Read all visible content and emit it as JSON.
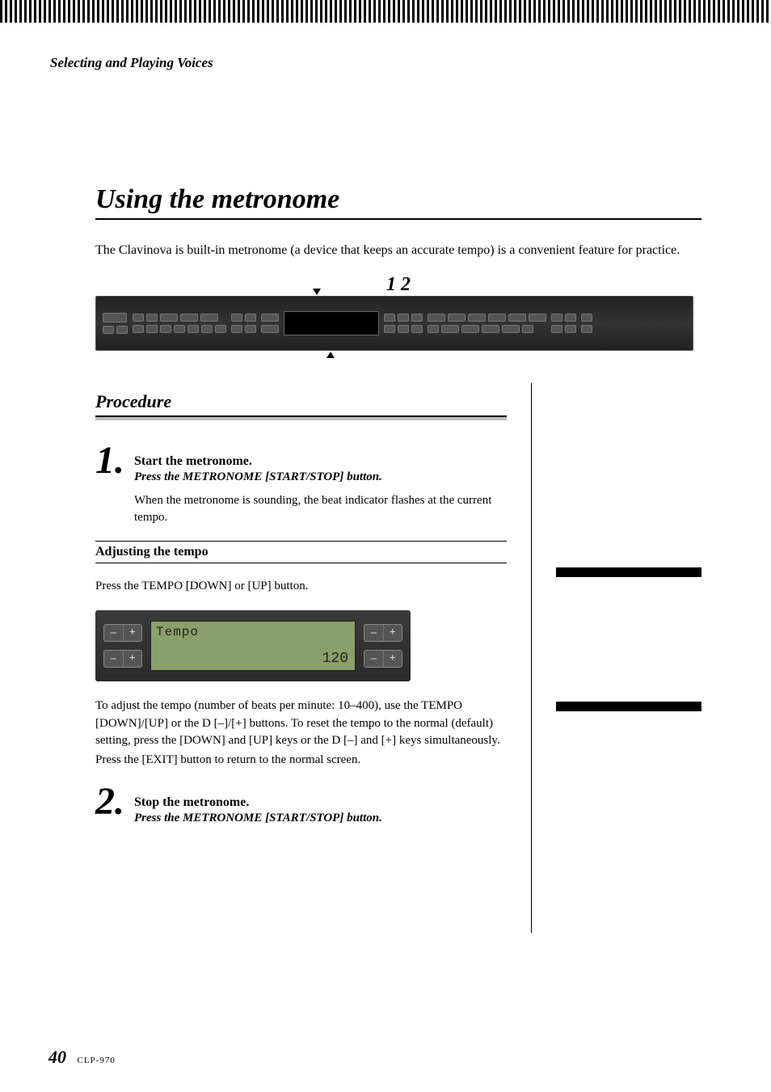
{
  "chapter": "Selecting and Playing Voices",
  "section_title": "Using the metronome",
  "intro": "The Clavinova is built-in metronome (a device that keeps an accurate tempo) is a convenient feature for practice.",
  "figure_callouts": "1 2",
  "procedure_heading": "Procedure",
  "steps": [
    {
      "num": "1.",
      "title": "Start the metronome.",
      "instruction": "Press the METRONOME [START/STOP] button.",
      "desc": "When the metronome is sounding, the beat indicator flashes at the current tempo."
    },
    {
      "num": "2.",
      "title": "Stop the metronome.",
      "instruction": "Press the METRONOME [START/STOP] button.",
      "desc": ""
    }
  ],
  "subheading": "Adjusting the tempo",
  "adjust_intro": "Press the TEMPO [DOWN] or [UP] button.",
  "lcd": {
    "label": "Tempo",
    "value": "120",
    "minus": "–",
    "plus": "+"
  },
  "adjust_detail": "To adjust the tempo (number of beats per minute: 10–400), use the TEMPO [DOWN]/[UP] or the D [–]/[+] buttons. To reset the tempo to the normal (default) setting, press the [DOWN] and [UP] keys or the D [–] and [+] keys simultaneously.",
  "adjust_exit": "Press the [EXIT] button to return to the normal screen.",
  "footer": {
    "page": "40",
    "model": "CLP-970"
  }
}
